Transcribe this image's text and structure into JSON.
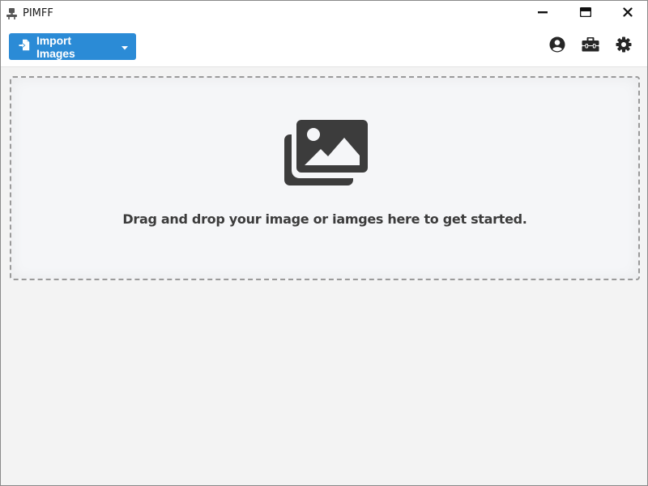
{
  "window": {
    "title": "PIMFF",
    "controls": {
      "minimize_icon": "minimize-icon",
      "maximize_icon": "maximize-icon",
      "close_icon": "close-icon"
    }
  },
  "toolbar": {
    "import_button": {
      "label": "Import Images",
      "icon": "file-import-icon",
      "dropdown_icon": "caret-down-icon",
      "color": "#2b8bd6"
    },
    "actions": [
      {
        "name": "user-circle-icon"
      },
      {
        "name": "toolbox-icon"
      },
      {
        "name": "gear-icon"
      }
    ]
  },
  "dropzone": {
    "icon": "images-icon",
    "message": "Drag and drop your image or iamges here to get started."
  },
  "colors": {
    "accent": "#2b8bd6",
    "icon_dark": "#3c3c3c",
    "background": "#f3f3f3"
  }
}
